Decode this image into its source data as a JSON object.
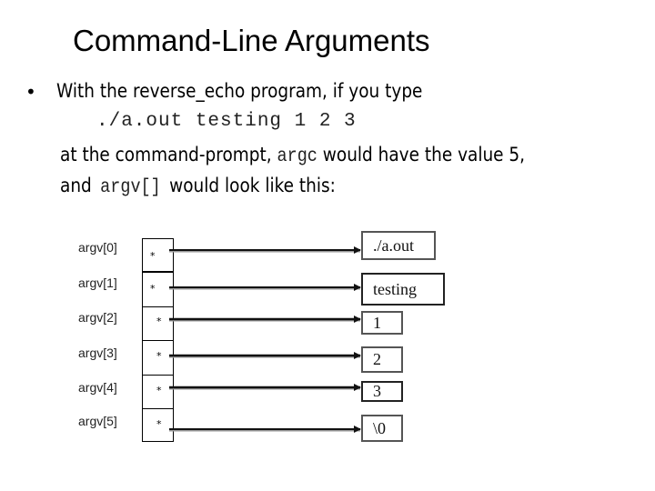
{
  "slide": {
    "title": "Command-Line Arguments",
    "bullet_symbol": "•",
    "lines": {
      "line1": "With the reverse_echo program, if you type",
      "command": "./a.out testing 1 2 3",
      "line3_pre": "at the command-prompt,",
      "line3_code": "argc",
      "line3_post": "would have the value 5,",
      "line4_pre": "and",
      "line4_code": "argv[]",
      "line4_post": "would look like this:"
    }
  },
  "diagram": {
    "pointer_symbol": "*",
    "entries": [
      {
        "label": "argv[0]",
        "value": "./a.out"
      },
      {
        "label": "argv[1]",
        "value": "testing"
      },
      {
        "label": "argv[2]",
        "value": "1"
      },
      {
        "label": "argv[3]",
        "value": "2"
      },
      {
        "label": "argv[4]",
        "value": "3"
      },
      {
        "label": "argv[5]",
        "value": "\\0"
      }
    ]
  }
}
